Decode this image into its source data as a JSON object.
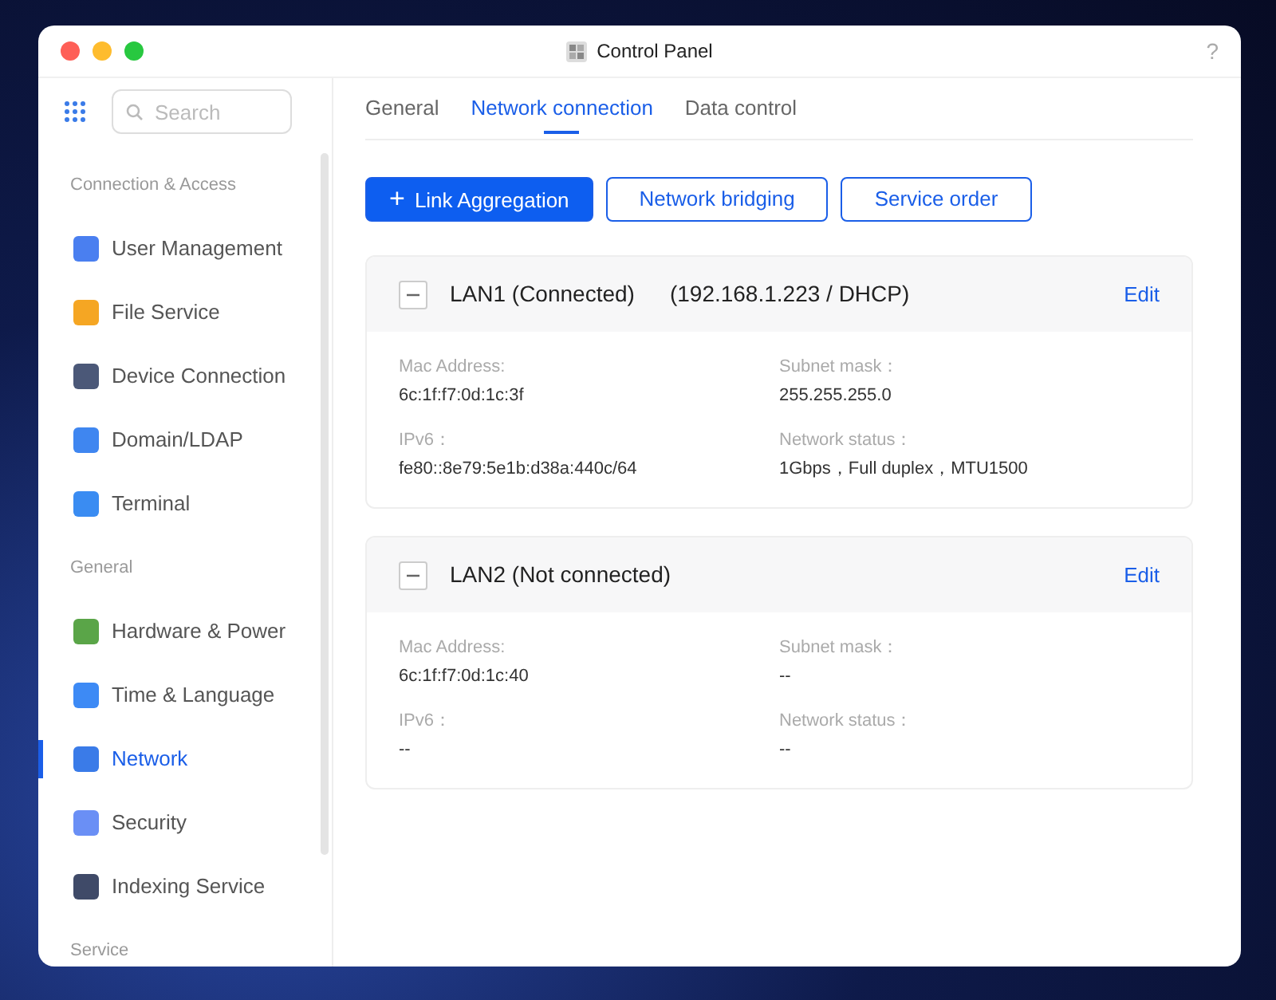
{
  "window": {
    "title": "Control Panel",
    "help": "?"
  },
  "sidebar": {
    "search": {
      "placeholder": "Search"
    },
    "items": [
      {
        "kind": "section",
        "label": "Connection & Access"
      },
      {
        "kind": "item",
        "label": "User Management",
        "selected": false,
        "color": "#4a7ff0"
      },
      {
        "kind": "item",
        "label": "File Service",
        "selected": false,
        "color": "#f5a623"
      },
      {
        "kind": "item",
        "label": "Device Connection",
        "selected": false,
        "color": "#4b5878"
      },
      {
        "kind": "item",
        "label": "Domain/LDAP",
        "selected": false,
        "color": "#3f86f0"
      },
      {
        "kind": "item",
        "label": "Terminal",
        "selected": false,
        "color": "#3a8cf2"
      },
      {
        "kind": "section",
        "label": "General"
      },
      {
        "kind": "item",
        "label": "Hardware & Power",
        "selected": false,
        "color": "#5aa548"
      },
      {
        "kind": "item",
        "label": "Time & Language",
        "selected": false,
        "color": "#3d8af5"
      },
      {
        "kind": "item",
        "label": "Network",
        "selected": true,
        "color": "#3a7be8"
      },
      {
        "kind": "item",
        "label": "Security",
        "selected": false,
        "color": "#6a8ff5"
      },
      {
        "kind": "item",
        "label": "Indexing Service",
        "selected": false,
        "color": "#3f4a68"
      },
      {
        "kind": "section",
        "label": "Service"
      }
    ]
  },
  "tabs": [
    {
      "label": "General",
      "selected": false
    },
    {
      "label": "Network connection",
      "selected": true
    },
    {
      "label": "Data control",
      "selected": false
    }
  ],
  "buttons": [
    {
      "label": "Link Aggregation",
      "icon": "+",
      "primary": true
    },
    {
      "label": "Network bridging",
      "primary": false
    },
    {
      "label": "Service order",
      "primary": false
    }
  ],
  "interfaces": [
    {
      "name": "LAN1 (Connected)",
      "address": "(192.168.1.223 / DHCP)",
      "expanded": true,
      "edit": "Edit",
      "fields": [
        {
          "label": "Mac Address:",
          "value": "6c:1f:f7:0d:1c:3f"
        },
        {
          "label": "Subnet mask：",
          "value": "255.255.255.0"
        },
        {
          "label": "IPv6：",
          "value": "fe80::8e79:5e1b:d38a:440c/64"
        },
        {
          "label": "Network status：",
          "value": "1Gbps，Full duplex，MTU1500"
        }
      ]
    },
    {
      "name": "LAN2 (Not connected)",
      "expanded": true,
      "edit": "Edit",
      "fields": [
        {
          "label": "Mac Address:",
          "value": "6c:1f:f7:0d:1c:40"
        },
        {
          "label": "Subnet mask：",
          "value": "--"
        },
        {
          "label": "IPv6：",
          "value": "--"
        },
        {
          "label": "Network status：",
          "value": "--"
        }
      ]
    }
  ]
}
